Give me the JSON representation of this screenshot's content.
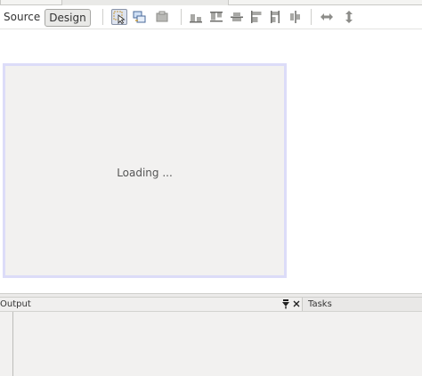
{
  "editor": {
    "view_tabs": {
      "source_label": "Source",
      "design_label": "Design"
    },
    "toolbar_icons": [
      "selection-mode-icon",
      "connection-mode-icon",
      "preview-design-icon",
      "align-bottom-icon",
      "align-top-icon",
      "center-vertically-icon",
      "align-left-icon",
      "align-right-icon",
      "center-horizontally-icon",
      "change-horizontal-resizability-icon",
      "change-vertical-resizability-icon"
    ]
  },
  "design_canvas": {
    "status_text": "Loading ..."
  },
  "bottom_panel": {
    "output_title": "Output",
    "tasks_title": "Tasks"
  },
  "colors": {
    "canvas_border": "#dcdcf8",
    "canvas_background": "#f2f1f0",
    "active_icon_background": "#dde3ef"
  }
}
